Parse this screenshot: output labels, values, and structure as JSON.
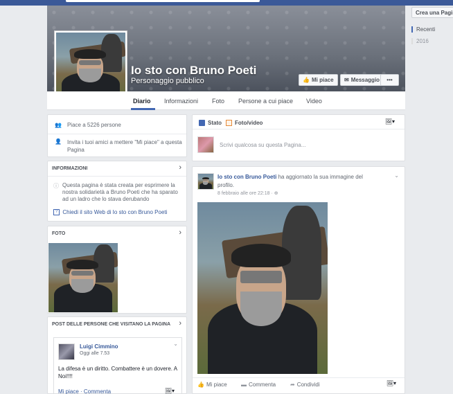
{
  "page": {
    "name": "Io sto con Bruno Poeti",
    "category": "Personaggio pubblico"
  },
  "cover_buttons": {
    "like": "Mi piace",
    "message": "Messaggio",
    "more": "•••"
  },
  "tabs": [
    {
      "label": "Diario"
    },
    {
      "label": "Informazioni"
    },
    {
      "label": "Foto"
    },
    {
      "label": "Persone a cui piace"
    },
    {
      "label": "Video"
    }
  ],
  "likes_card": {
    "likes_text": "Piace a 5226 persone",
    "invite_text": "Invita i tuoi amici a mettere \"Mi piace\" a questa Pagina"
  },
  "info_card": {
    "heading": "INFORMAZIONI",
    "description": "Questa pagina è stata creata per esprimere la nostra solidarietà a Bruno Poeti che ha sparato ad un ladro che lo stava derubando",
    "website_link": "Chiedi il sito Web di Io sto con Bruno Poeti"
  },
  "photos_card": {
    "heading": "FOTO"
  },
  "visitor_posts_card": {
    "heading": "POST DELLE PERSONE CHE VISITANO LA PAGINA",
    "post": {
      "author": "Luigi Cimmino",
      "time": "Oggi alle 7.53",
      "text": "La difesa è un diritto. Combattere è un dovere. A Noi!!!!",
      "actions": "Mi piace · Commenta"
    }
  },
  "composer": {
    "tab_status": "Stato",
    "tab_photo": "Foto/video",
    "placeholder": "Scrivi qualcosa su questa Pagina..."
  },
  "feed_post": {
    "author": "Io sto con Bruno Poeti",
    "action_text": "ha aggiornato la sua immagine del profilo.",
    "time": "8 febbraio alle ore 22:18 ·",
    "like_label": "Mi piace",
    "comment_label": "Commenta",
    "share_label": "Condividi"
  },
  "right_rail": {
    "create_button": "Crea una Pagina",
    "recent": "Recenti",
    "year": "2016"
  },
  "colors": {
    "brand": "#3b5998",
    "link": "#365899",
    "accent": "#4267b2"
  }
}
